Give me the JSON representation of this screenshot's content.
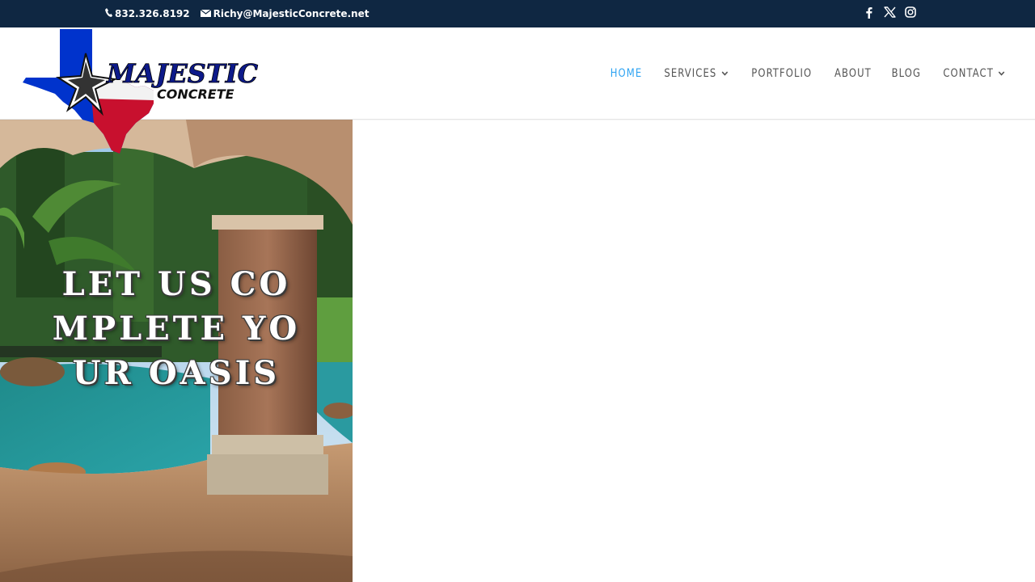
{
  "topbar": {
    "phone": "832.326.8192",
    "email": "Richy@MajesticConcrete.net",
    "social": [
      "facebook-icon",
      "x-icon",
      "instagram-icon"
    ]
  },
  "brand": {
    "logo_word_main": "MAJESTIC",
    "logo_word_sub": "CONCRETE",
    "colors": {
      "navy": "#0f2742",
      "blue": "#0033cc",
      "red": "#c8102e",
      "accent": "#2ea3f2"
    }
  },
  "nav": {
    "items": [
      {
        "label": "HOME",
        "active": true,
        "has_dropdown": false
      },
      {
        "label": "SERVICES",
        "active": false,
        "has_dropdown": true
      },
      {
        "label": "PORTFOLIO",
        "active": false,
        "has_dropdown": false
      },
      {
        "label": "ABOUT",
        "active": false,
        "has_dropdown": false
      },
      {
        "label": "BLOG",
        "active": false,
        "has_dropdown": false
      },
      {
        "label": "CONTACT",
        "active": false,
        "has_dropdown": true
      }
    ]
  },
  "hero": {
    "title": "LET US COMPLETE YOUR OASIS"
  }
}
